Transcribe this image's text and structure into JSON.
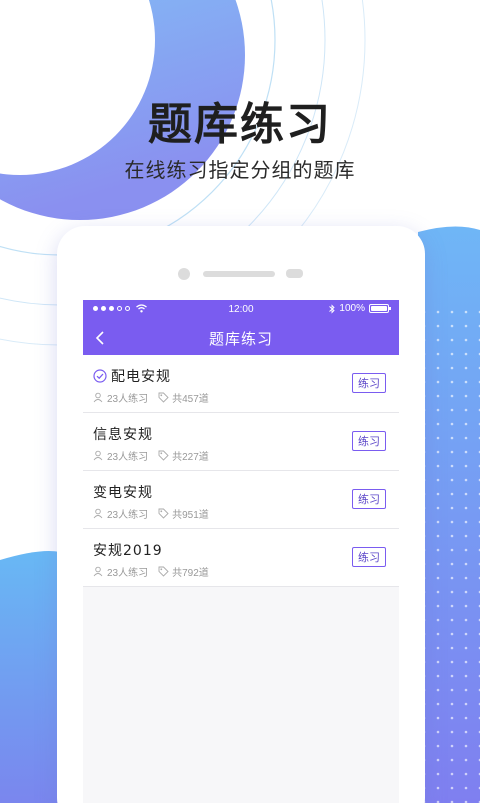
{
  "hero": {
    "title": "题库练习",
    "subtitle": "在线练习指定分组的题库"
  },
  "statusbar": {
    "time": "12:00",
    "battery": "100%",
    "icons": [
      "signal-dots-icon",
      "wifi-icon",
      "bluetooth-icon",
      "battery-icon"
    ]
  },
  "navbar": {
    "title": "题库练习",
    "back_icon": "chevron-left-icon"
  },
  "question_banks": [
    {
      "name": "配电安规",
      "selected": true,
      "participants": "23人练习",
      "total": "共457道",
      "action": "练习"
    },
    {
      "name": "信息安规",
      "selected": false,
      "participants": "23人练习",
      "total": "共227道",
      "action": "练习"
    },
    {
      "name": "变电安规",
      "selected": false,
      "participants": "23人练习",
      "total": "共951道",
      "action": "练习"
    },
    {
      "name": "安规2019",
      "selected": false,
      "participants": "23人练习",
      "total": "共792道",
      "action": "练习"
    }
  ],
  "colors": {
    "accent": "#7a5cf0",
    "deco_blue": "#7fc4f5",
    "deco_purple": "#7d8ff0"
  }
}
